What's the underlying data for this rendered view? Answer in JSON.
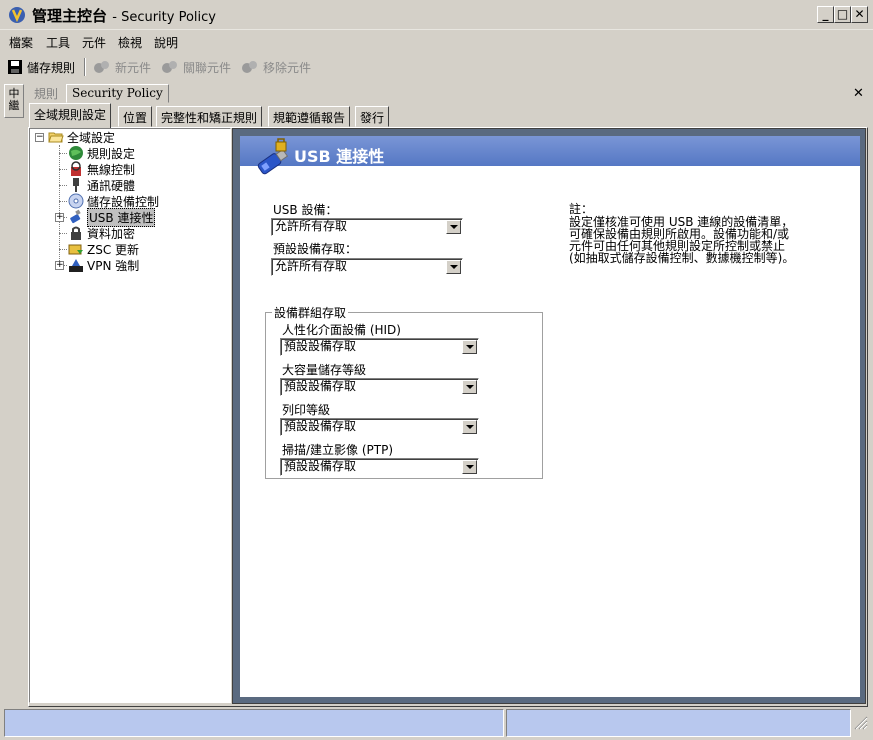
{
  "window": {
    "title": "管理主控台",
    "subtitle": "- Security Policy",
    "minimize": "_",
    "maximize": "□",
    "close": "✕"
  },
  "menu": [
    "檔案",
    "工具",
    "元件",
    "檢視",
    "說明"
  ],
  "toolbar": {
    "save": "儲存規則",
    "new": "新元件",
    "link": "關聯元件",
    "remove": "移除元件"
  },
  "side_tab": "中繼",
  "doc": {
    "label": "規則",
    "tab": "Security Policy",
    "close": "✕"
  },
  "settings_tabs": [
    "全域規則設定",
    "位置",
    "完整性和矯正規則",
    "規範遵循報告",
    "發行"
  ],
  "tree": {
    "root": "全域設定",
    "items": [
      "規則設定",
      "無線控制",
      "通訊硬體",
      "儲存設備控制",
      "USB 連接性",
      "資料加密",
      "ZSC 更新",
      "VPN 強制"
    ],
    "root_expander": "−",
    "item_expander": "+"
  },
  "panel": {
    "title": "USB 連接性",
    "usb_devices_label": "USB 設備：",
    "usb_devices_value": "允許所有存取",
    "default_access_label": "預設設備存取：",
    "default_access_value": "允許所有存取",
    "group_title": "設備群組存取",
    "groups": [
      {
        "label": "人性化介面設備 (HID)",
        "value": "預設設備存取"
      },
      {
        "label": "大容量儲存等級",
        "value": "預設設備存取"
      },
      {
        "label": "列印等級",
        "value": "預設設備存取"
      },
      {
        "label": "掃描/建立影像 (PTP)",
        "value": "預設設備存取"
      }
    ],
    "note_title": "註：",
    "note_text": "設定僅核准可使用 USB 連線的設備清單，可確保設備由規則所啟用。設備功能和/或元件可由任何其他規則設定所控制或禁止 (如抽取式儲存設備控制、數據機控制等)。"
  }
}
